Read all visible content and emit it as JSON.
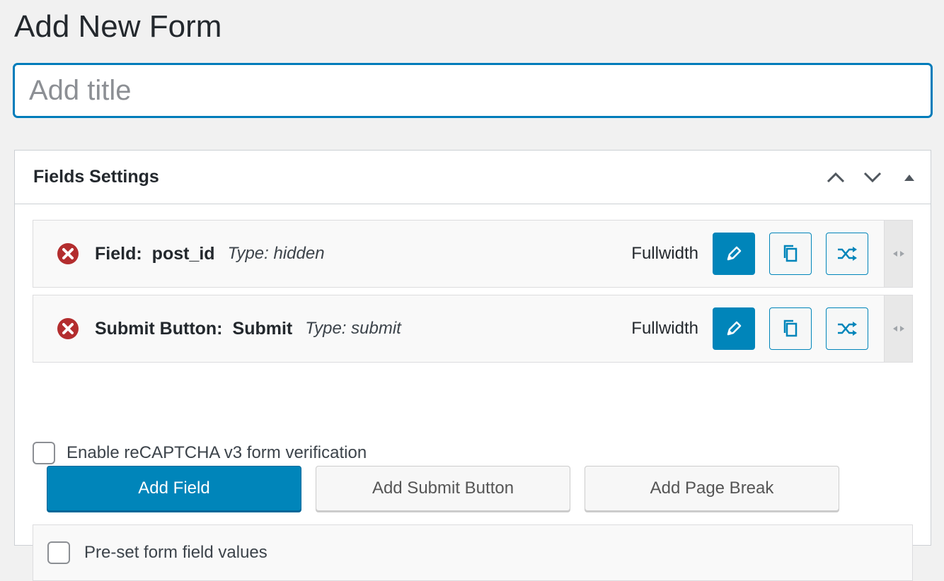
{
  "page": {
    "title": "Add New Form",
    "title_placeholder": "Add title"
  },
  "panel": {
    "title": "Fields Settings",
    "icons": [
      "chevron-up-icon",
      "chevron-down-icon",
      "triangle-up-icon"
    ]
  },
  "fields": [
    {
      "label": "Field:",
      "name": "post_id",
      "type": "Type: hidden",
      "width": "Fullwidth"
    },
    {
      "label": "Submit Button:",
      "name": "Submit",
      "type": "Type: submit",
      "width": "Fullwidth"
    }
  ],
  "recaptcha": {
    "label": "Enable reCAPTCHA v3 form verification",
    "checked": false
  },
  "buttons": {
    "add_field": "Add Field",
    "add_submit": "Add Submit Button",
    "add_page_break": "Add Page Break"
  },
  "preset": {
    "label": "Pre-set form field values",
    "checked": false
  },
  "colors": {
    "accent": "#0085ba",
    "delete": "#b32d2e",
    "background": "#f1f1f1"
  }
}
